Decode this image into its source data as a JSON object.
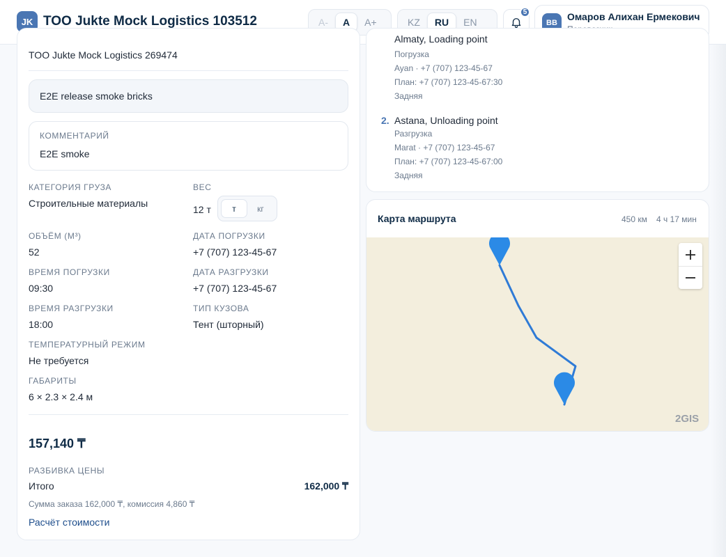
{
  "header": {
    "logo": "JK",
    "company": "TOO Jukte Mock Logistics 103512",
    "font_sizes": [
      "A-",
      "A",
      "A+"
    ],
    "languages": [
      "KZ",
      "RU",
      "EN"
    ],
    "notifications_count": "5",
    "user": {
      "initials": "BB",
      "name": "Омаров Алихан Ермекович",
      "role": "Перевозчик"
    }
  },
  "order": {
    "company": "TOO Jukte Mock Logistics 269474",
    "note": "E2E release smoke bricks",
    "comment_label": "Комментарий",
    "comment": "E2E smoke",
    "fields": [
      {
        "label": "Категория груза",
        "value": "Строительные материалы"
      },
      {
        "label": "Вес",
        "value": "12 т"
      },
      {
        "label": "Объём (м³)",
        "value": "52"
      },
      {
        "label": "Дата погрузки",
        "value": "+7 (707) 123-45-67"
      },
      {
        "label": "Время погрузки",
        "value": "09:30"
      },
      {
        "label": "Дата разгрузки",
        "value": "+7 (707) 123-45-67"
      },
      {
        "label": "Время разгрузки",
        "value": "18:00"
      },
      {
        "label": "Тип кузова",
        "value": "Тент (шторный)"
      },
      {
        "label": "Температурный режим",
        "value": "Не требуется"
      },
      {
        "label": "Габариты",
        "value": "6 × 2.3 × 2.4 м"
      }
    ],
    "weight_units": [
      "т",
      "кг"
    ],
    "price": "157,140 ₸",
    "breakdown_label": "Разбивка цены",
    "total_label": "Итого",
    "total_value": "162,000 ₸",
    "breakdown_note": "Сумма заказа 162,000 ₸, комиссия 4,860 ₸",
    "calc_link": "Расчёт стоимости"
  },
  "route": {
    "stop1": {
      "partial_title": "Almaty, Loading point",
      "type": "Погрузка",
      "contact": "Ayan · +7 (707) 123-45-67",
      "plan": "План: +7 (707) 123-45-67:30",
      "side": "Задняя"
    },
    "stop2": {
      "number": "2.",
      "title": "Astana, Unloading point",
      "type": "Разгрузка",
      "contact": "Marat · +7 (707) 123-45-67",
      "plan": "План: +7 (707) 123-45-67:00",
      "side": "Задняя"
    }
  },
  "map": {
    "title": "Карта маршрута",
    "distance": "450 км",
    "duration": "4 ч 17 мин",
    "provider": "2GIS",
    "route_color": "#2f7bd6",
    "pin_color": "#2b8ae6",
    "background_color": "#f3eedd"
  },
  "colors": {
    "accent": "#4a76b3",
    "title": "#0f2b46",
    "muted": "#6b7a8d"
  }
}
